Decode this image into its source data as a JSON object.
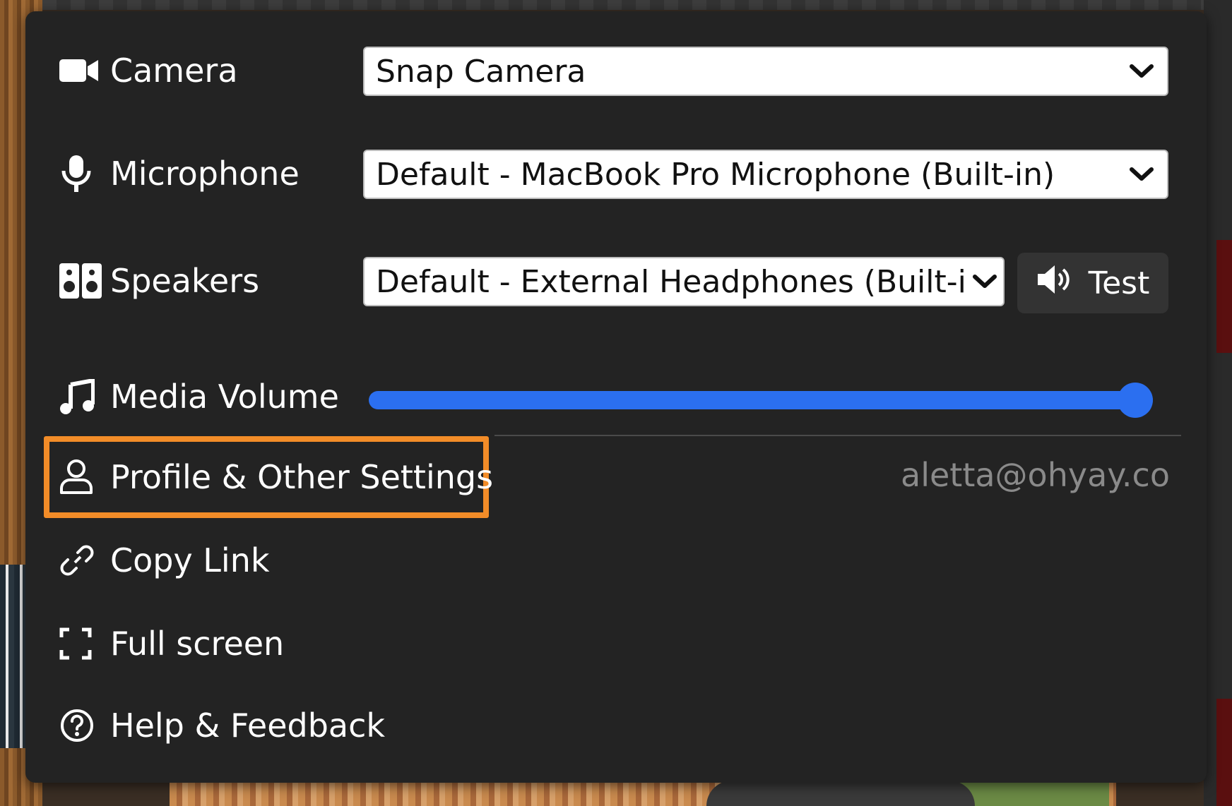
{
  "menu": {
    "camera": {
      "label": "Camera",
      "selected": "Snap Camera"
    },
    "microphone": {
      "label": "Microphone",
      "selected": "Default - MacBook Pro Microphone (Built-in)"
    },
    "speakers": {
      "label": "Speakers",
      "selected": "Default - External Headphones (Built-in)",
      "test_label": "Test"
    },
    "media_volume": {
      "label": "Media Volume",
      "value_percent": 100
    },
    "profile": {
      "label": "Profile & Other Settings",
      "email": "aletta@ohyay.co"
    },
    "copy_link": {
      "label": "Copy Link"
    },
    "full_screen": {
      "label": "Full screen"
    },
    "help": {
      "label": "Help & Feedback"
    }
  },
  "colors": {
    "menu_bg": "#232323",
    "accent": "#2b6ff0",
    "highlight": "#f28c28",
    "email_text": "#8a8a8a"
  },
  "icons": [
    "video-camera-icon",
    "microphone-icon",
    "speakers-icon",
    "speaker-volume-icon",
    "music-note-icon",
    "user-icon",
    "link-icon",
    "fullscreen-icon",
    "help-circle-icon",
    "chevron-down-icon"
  ]
}
